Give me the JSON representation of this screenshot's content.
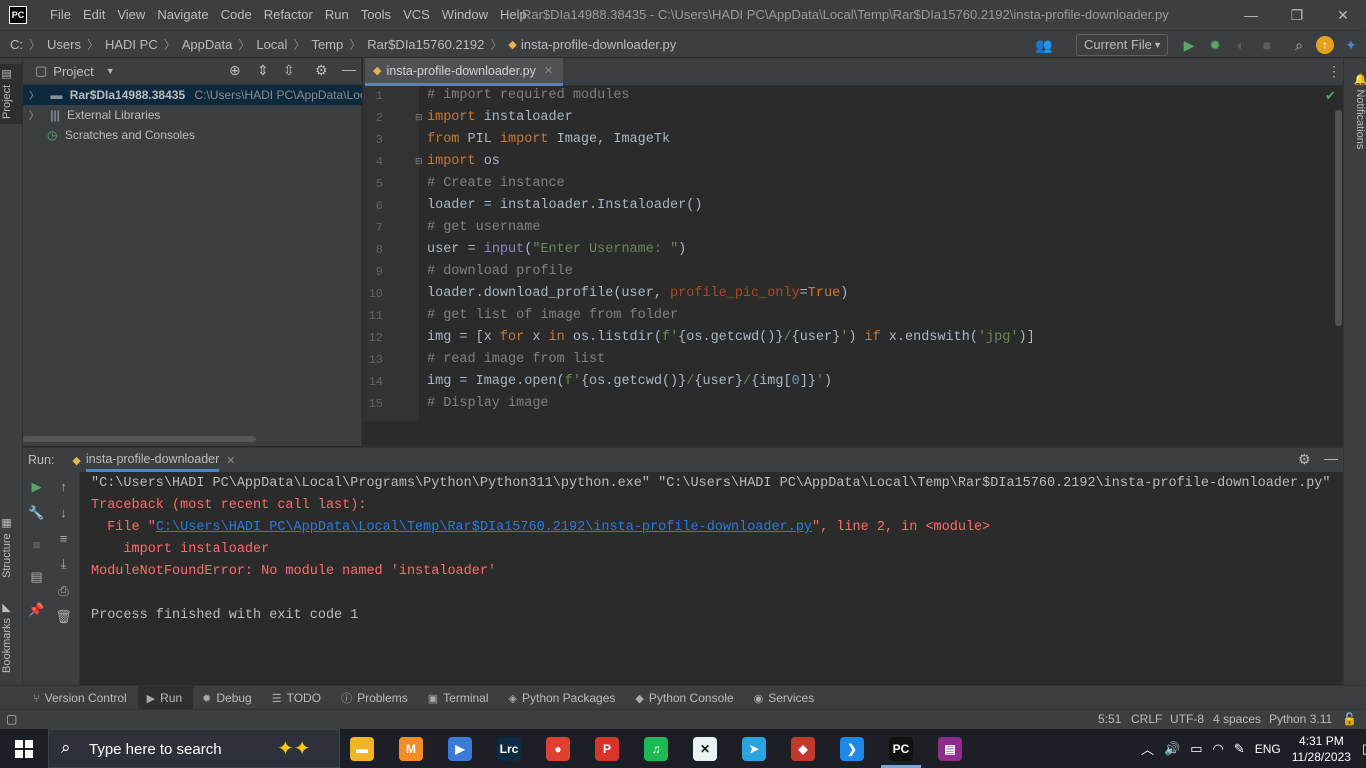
{
  "window": {
    "title": "Rar$DIa14988.38435 - C:\\Users\\HADI PC\\AppData\\Local\\Temp\\Rar$DIa15760.2192\\insta-profile-downloader.py",
    "logo": "PC",
    "min": "—",
    "max": "❐",
    "close": "✕"
  },
  "menu": [
    "File",
    "Edit",
    "View",
    "Navigate",
    "Code",
    "Refactor",
    "Run",
    "Tools",
    "VCS",
    "Window",
    "Help"
  ],
  "breadcrumb": [
    "C:",
    "Users",
    "HADI PC",
    "AppData",
    "Local",
    "Temp",
    "Rar$DIa15760.2192",
    "insta-profile-downloader.py"
  ],
  "toolbar": {
    "run_config": "Current File"
  },
  "left_strip": {
    "project": "Project",
    "structure": "Structure",
    "bookmarks": "Bookmarks"
  },
  "right_strip": {
    "notifications": "Notifications"
  },
  "project": {
    "title": "Project",
    "tree": [
      {
        "label": "Rar$DIa14988.38435",
        "path": "C:\\Users\\HADI PC\\AppData\\Loca"
      },
      {
        "label": "External Libraries"
      },
      {
        "label": "Scratches and Consoles"
      }
    ]
  },
  "editor": {
    "tab": "insta-profile-downloader.py",
    "line_numbers": [
      "1",
      "2",
      "3",
      "4",
      "5",
      "6",
      "7",
      "8",
      "9",
      "10",
      "11",
      "12",
      "13",
      "14",
      "15"
    ],
    "lines": {
      "l1": "# import required modules",
      "l2a": "import",
      "l2b": " instaloader",
      "l3a": "from",
      "l3b": " PIL ",
      "l3c": "import",
      "l3d": " Image, ImageTk",
      "l4a": "import",
      "l4b": " os",
      "l5": "# Create instance",
      "l6": "loader = instaloader.Instaloader()",
      "l7": "# get username",
      "l8a": "user = ",
      "l8b": "input",
      "l8c": "(",
      "l8d": "\"Enter Username: \"",
      "l8e": ")",
      "l9": "# download profile",
      "l10a": "loader.download_profile(user, ",
      "l10b": "profile_pic_only",
      "l10c": "=",
      "l10d": "True",
      "l10e": ")",
      "l11": "# get list of image from folder",
      "l12a": "img = [x ",
      "l12b": "for",
      "l12c": " x ",
      "l12d": "in",
      "l12e": " os.listdir(",
      "l12f": "f'",
      "l12g": "{os.getcwd()}",
      "l12h": "/",
      "l12i": "{user}",
      "l12j": "'",
      "l12k": ") ",
      "l12l": "if",
      "l12m": " x.endswith(",
      "l12n": "'jpg'",
      "l12o": ")]",
      "l13": "# read image from list",
      "l14a": "img = Image.open(",
      "l14b": "f'",
      "l14c": "{os.getcwd()}",
      "l14d": "/",
      "l14e": "{user}",
      "l14f": "/",
      "l14g": "{img[",
      "l14h": "0",
      "l14i": "]}",
      "l14j": "'",
      "l14k": ")",
      "l15": "# Display image"
    }
  },
  "run": {
    "label": "Run:",
    "tab": "insta-profile-downloader",
    "console": {
      "c1": "\"C:\\Users\\HADI PC\\AppData\\Local\\Programs\\Python\\Python311\\python.exe\" \"C:\\Users\\HADI PC\\AppData\\Local\\Temp\\Rar$DIa15760.2192\\insta-profile-downloader.py\"",
      "c2": "Traceback (most recent call last):",
      "c3a": "  File \"",
      "c3b": "C:\\Users\\HADI PC\\AppData\\Local\\Temp\\Rar$DIa15760.2192\\insta-profile-downloader.py",
      "c3c": "\", line 2, in <module>",
      "c4": "    import instaloader",
      "c5": "ModuleNotFoundError: No module named 'instaloader'",
      "c6": "Process finished with exit code 1"
    }
  },
  "bottom_tabs": [
    "Version Control",
    "Run",
    "Debug",
    "TODO",
    "Problems",
    "Terminal",
    "Python Packages",
    "Python Console",
    "Services"
  ],
  "status": {
    "pos": "5:51",
    "eol": "CRLF",
    "enc": "UTF-8",
    "indent": "4 spaces",
    "interp": "Python 3.11"
  },
  "taskbar": {
    "search_placeholder": "Type here to search",
    "lang": "ENG",
    "time": "4:31 PM",
    "date": "11/28/2023",
    "apps": [
      {
        "name": "file-explorer",
        "label": "▬",
        "color": "#f0b429"
      },
      {
        "name": "sublime-merge",
        "label": "M",
        "color": "#f28c28"
      },
      {
        "name": "media-player",
        "label": "▶",
        "color": "#3a7bd5"
      },
      {
        "name": "lightroom-classic",
        "label": "Lrc",
        "color": "#0b2a44"
      },
      {
        "name": "chrome",
        "label": "●",
        "color": "#de4032"
      },
      {
        "name": "wps-pdf",
        "label": "P",
        "color": "#d9342b"
      },
      {
        "name": "spotify",
        "label": "♫",
        "color": "#1db954"
      },
      {
        "name": "capcut",
        "label": "✕",
        "color": "#e8f4f4"
      },
      {
        "name": "telegram",
        "label": "➤",
        "color": "#2aa3df"
      },
      {
        "name": "virtualbox",
        "label": "◆",
        "color": "#c0392b"
      },
      {
        "name": "vscode",
        "label": "❯",
        "color": "#1e88e5"
      },
      {
        "name": "pycharm",
        "label": "PC",
        "color": "#111111"
      },
      {
        "name": "winrar",
        "label": "▤",
        "color": "#8e2c8e"
      }
    ]
  }
}
